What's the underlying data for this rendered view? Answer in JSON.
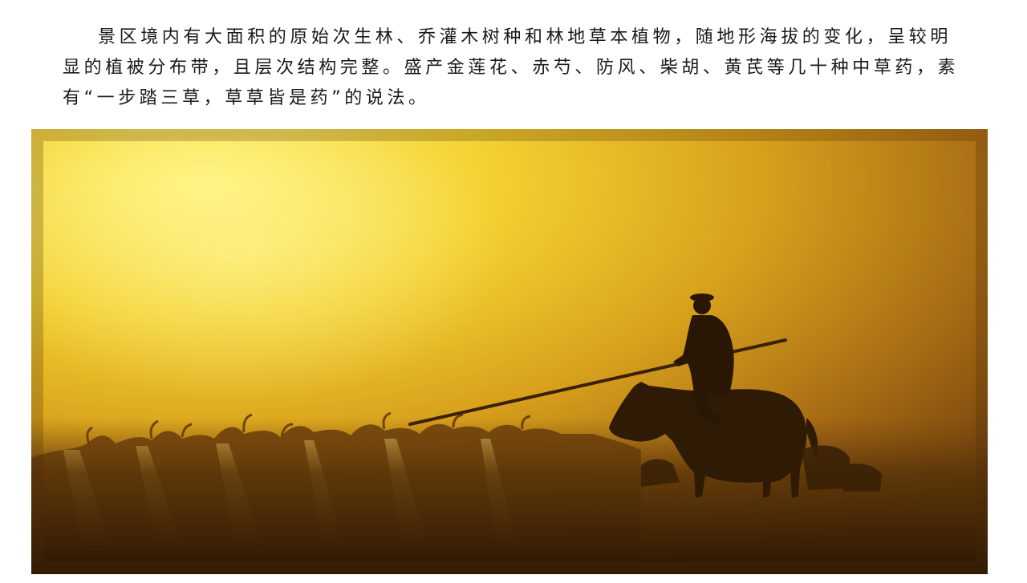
{
  "document": {
    "paragraph": "景区境内有大面积的原始次生林、乔灌木树种和林地草本植物，随地形海拔的变化，呈较明显的植被分布带，且层次结构完整。盛产金莲花、赤芍、防风、柴胡、黄芪等几十种中草药，素有“一步踏三草，草草皆是药”的说法。"
  },
  "photo": {
    "subject": "silhouette-herder-on-horse-with-flock",
    "colors": {
      "glow": "#fff06a",
      "amber": "#e8b21c",
      "deep": "#8a5510",
      "dark": "#2a1604"
    }
  }
}
